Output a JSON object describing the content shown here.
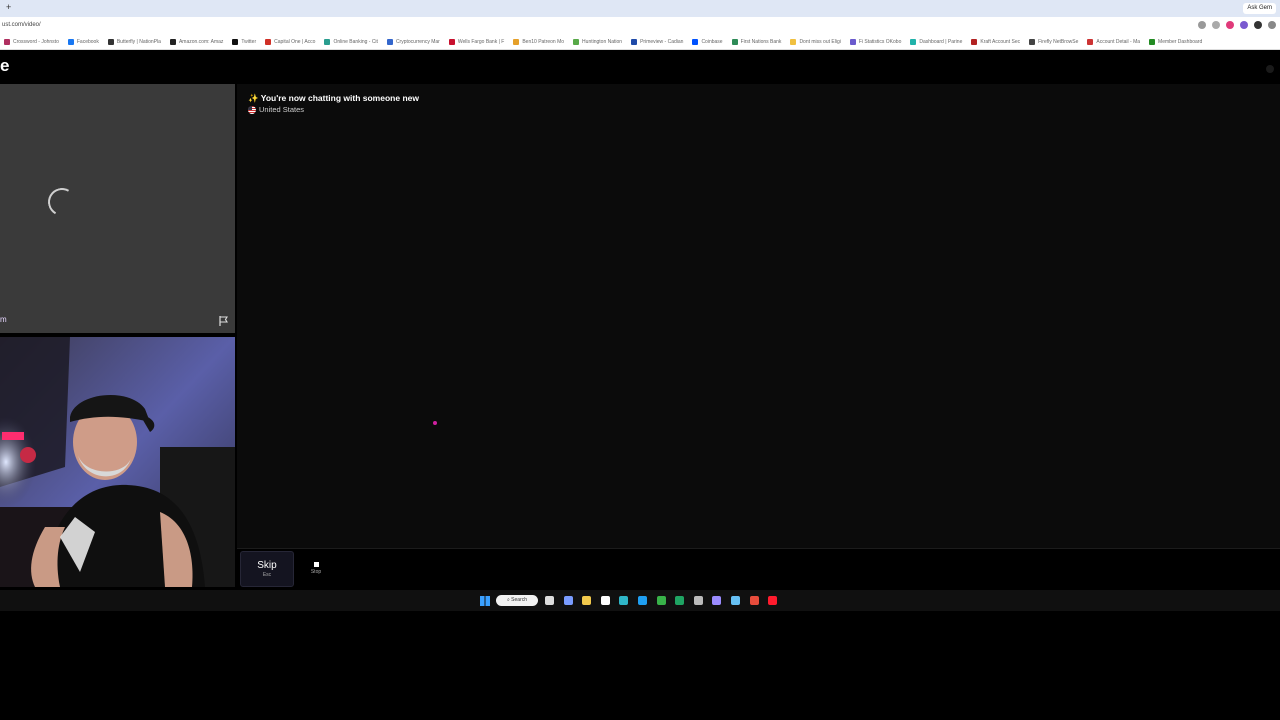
{
  "browser": {
    "tab_new": "+",
    "tab_account": "Ask Gem",
    "url": "ust.com/video/",
    "bookmarks": [
      {
        "label": "Crossword - Johnsto",
        "color": "#b03060"
      },
      {
        "label": "Facebook",
        "color": "#1877f2"
      },
      {
        "label": "Butterfly | NationPla",
        "color": "#333"
      },
      {
        "label": "Amazon.com: Amaz",
        "color": "#222"
      },
      {
        "label": "Twitter",
        "color": "#111"
      },
      {
        "label": "Capital One | Acco",
        "color": "#d03027"
      },
      {
        "label": "Online Banking - Cit",
        "color": "#2a9d8f"
      },
      {
        "label": "Cryptocurrency Mar",
        "color": "#3366cc"
      },
      {
        "label": "Wells Fargo Bank | F",
        "color": "#c8102e"
      },
      {
        "label": "Ben10 Patreon Mo",
        "color": "#e5a02a"
      },
      {
        "label": "Huntington Nation",
        "color": "#58a948"
      },
      {
        "label": "Primeview - Cadian",
        "color": "#1f4aa8"
      },
      {
        "label": "Coinbase",
        "color": "#0052ff"
      },
      {
        "label": "First Nations Bank",
        "color": "#2e8b57"
      },
      {
        "label": "Dont miss out Eligi",
        "color": "#f0c040"
      },
      {
        "label": "Fi Statistics OKobo",
        "color": "#6a5acd"
      },
      {
        "label": "Dashboard | Parine",
        "color": "#20b2aa"
      },
      {
        "label": "Kraft Account Sec",
        "color": "#b22222"
      },
      {
        "label": "Firefly NetBrowSe",
        "color": "#444"
      },
      {
        "label": "Account Detail - Ma",
        "color": "#cc3333"
      },
      {
        "label": "Member Dashboard",
        "color": "#228b22"
      }
    ],
    "action_colors": [
      "#999999",
      "#aaaaaa",
      "#e03a7a",
      "#7a5ad0",
      "#333333",
      "#888888"
    ]
  },
  "site": {
    "logo_letter": "e"
  },
  "stranger": {
    "name": "m",
    "report_icon": "flag-icon",
    "status_icon": "loading-spinner"
  },
  "chat": {
    "message": "✨ You're now chatting with someone new",
    "country": "United States",
    "flag_icon": "us-flag-icon"
  },
  "controls": {
    "skip_label": "Skip",
    "skip_key": "Esc",
    "stop_label": "Stop"
  },
  "taskbar": {
    "search_label": "Search",
    "apps": [
      {
        "icon": "task-view-icon",
        "color": "#dddddd"
      },
      {
        "icon": "copilot-icon",
        "color": "#7a9cff"
      },
      {
        "icon": "file-explorer-icon",
        "color": "#f2c94c"
      },
      {
        "icon": "store-icon",
        "color": "#ffffff"
      },
      {
        "icon": "edge-icon",
        "color": "#2fb6c8"
      },
      {
        "icon": "browser-icon",
        "color": "#1f9ff2"
      },
      {
        "icon": "xbox-icon",
        "color": "#38b249"
      },
      {
        "icon": "sheets-icon",
        "color": "#1fa463"
      },
      {
        "icon": "calculator-icon",
        "color": "#bbbbbb"
      },
      {
        "icon": "snip-icon",
        "color": "#9b8cff"
      },
      {
        "icon": "steam-icon",
        "color": "#66c0f4"
      },
      {
        "icon": "chrome-icon",
        "color": "#e74c3c"
      },
      {
        "icon": "opera-icon",
        "color": "#ff1b2d"
      }
    ]
  }
}
